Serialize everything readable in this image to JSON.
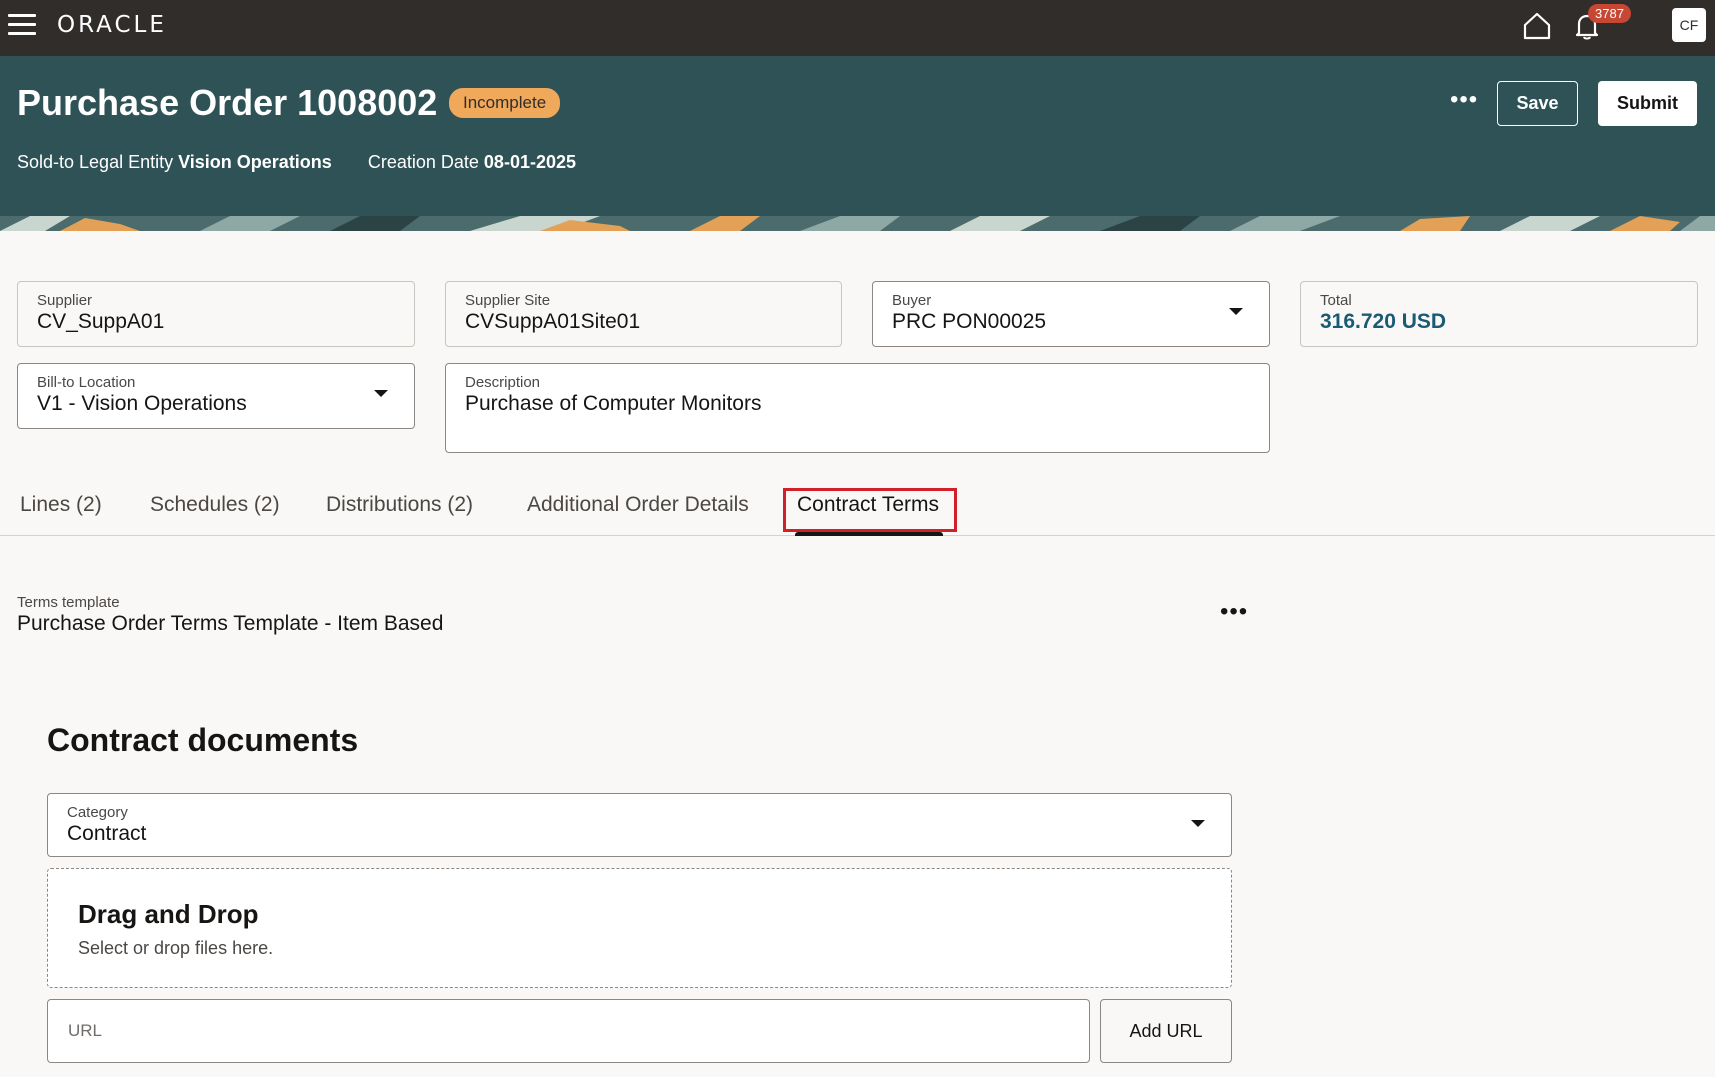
{
  "topbar": {
    "logo": "ORACLE",
    "notification_count": "3787",
    "avatar_initials": "CF"
  },
  "header": {
    "title": "Purchase Order 1008002",
    "status": "Incomplete",
    "legal_entity_label": "Sold-to Legal Entity",
    "legal_entity_value": "Vision Operations",
    "creation_date_label": "Creation Date",
    "creation_date_value": "08-01-2025",
    "more_label": "•••",
    "save_label": "Save",
    "submit_label": "Submit"
  },
  "fields": {
    "supplier": {
      "label": "Supplier",
      "value": "CV_SuppA01"
    },
    "supplier_site": {
      "label": "Supplier Site",
      "value": "CVSuppA01Site01"
    },
    "buyer": {
      "label": "Buyer",
      "value": "PRC PON00025"
    },
    "total": {
      "label": "Total",
      "value": "316.720 USD"
    },
    "bill_to": {
      "label": "Bill-to Location",
      "value": "V1 - Vision Operations"
    },
    "description": {
      "label": "Description",
      "value": "Purchase of Computer Monitors"
    }
  },
  "tabs": [
    {
      "label": "Lines  (2)"
    },
    {
      "label": "Schedules  (2)"
    },
    {
      "label": "Distributions  (2)"
    },
    {
      "label": "Additional Order Details"
    },
    {
      "label": "Contract Terms"
    }
  ],
  "terms": {
    "label": "Terms template",
    "value": "Purchase Order Terms Template - Item Based",
    "more_label": "•••"
  },
  "contract_documents": {
    "title": "Contract documents",
    "category_label": "Category",
    "category_value": "Contract",
    "dropzone_title": "Drag and Drop",
    "dropzone_sub": "Select or drop files here.",
    "url_placeholder": "URL",
    "add_url_label": "Add URL"
  },
  "colors": {
    "topbar": "#312d2a",
    "header": "#2f5256",
    "status_badge": "#f0a85a",
    "notification_badge": "#c74634",
    "highlight": "#d0202a",
    "link": "#1b5a73"
  }
}
